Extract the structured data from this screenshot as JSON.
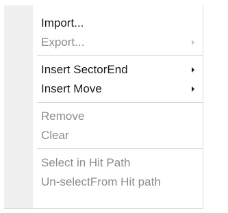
{
  "menu": {
    "items": [
      {
        "label": "Import...",
        "enabled": true,
        "submenu": false
      },
      {
        "label": "Export...",
        "enabled": false,
        "submenu": true
      },
      {
        "label": "Insert SectorEnd",
        "enabled": true,
        "submenu": true
      },
      {
        "label": "Insert Move",
        "enabled": true,
        "submenu": true
      },
      {
        "label": "Remove",
        "enabled": false,
        "submenu": false
      },
      {
        "label": "Clear",
        "enabled": false,
        "submenu": false
      },
      {
        "label": "Select in Hit Path",
        "enabled": false,
        "submenu": false
      },
      {
        "label": "Un-selectFrom Hit path",
        "enabled": false,
        "submenu": false
      }
    ]
  },
  "colors": {
    "enabled_text": "#1a1a1a",
    "disabled_text": "#8c8c8c",
    "gutter": "#f0f0f0",
    "separator": "#cfcfcf"
  }
}
